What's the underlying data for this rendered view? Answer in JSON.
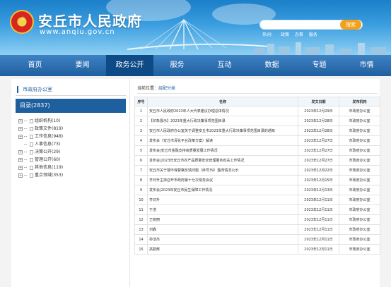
{
  "header": {
    "site_title": "安丘市人民政府",
    "site_url": "www.anqiu.gov.cn",
    "search_button": "搜索",
    "hot_label": "热词：",
    "hot_words": [
      "政策",
      "办事",
      "服务"
    ]
  },
  "nav": {
    "items": [
      "首页",
      "要闻",
      "政务公开",
      "服务",
      "互动",
      "数据",
      "专题",
      "市情"
    ],
    "active": "政务公开"
  },
  "sidebar": {
    "head": "市政府办公室",
    "catalog_label": "目录(2837)",
    "tree": [
      {
        "label": "组织机构(10)",
        "type": "folder"
      },
      {
        "label": "政策文件(819)",
        "type": "folder"
      },
      {
        "label": "工作信息(948)",
        "type": "folder"
      },
      {
        "label": "人事信息(73)",
        "type": "doc"
      },
      {
        "label": "决策公开(29)",
        "type": "folder"
      },
      {
        "label": "管理公开(60)",
        "type": "folder"
      },
      {
        "label": "其他信息(119)",
        "type": "folder"
      },
      {
        "label": "重点领域(353)",
        "type": "folder"
      }
    ]
  },
  "breadcrumb": {
    "label": "当前位置：",
    "current": "组配分类"
  },
  "table": {
    "headers": [
      "序号",
      "名称",
      "发文日期",
      "发布机构"
    ],
    "rows": [
      {
        "num": "1",
        "title": "安丘市人民政府2023年人大代表建议办理总体情况",
        "date": "2023年12月29日",
        "org": "市政府办公室"
      },
      {
        "num": "2",
        "title": "【印象展示】2023年重大行政决策事项范围目录",
        "date": "2023年12月28日",
        "org": "市政府办公室"
      },
      {
        "num": "3",
        "title": "安丘市人民政府办公室关于调整安丘市2023年重大行政决策事项范围目录的通知",
        "date": "2023年12月28日",
        "org": "市政府办公室"
      },
      {
        "num": "4",
        "title": "发布会（安丘市深化平台改革方案）解读",
        "date": "2023年12月27日",
        "org": "市政府办公室"
      },
      {
        "num": "5",
        "title": "发布会|安丘市金融支持高质量发展工作情况",
        "date": "2023年12月27日",
        "org": "市政府办公室"
      },
      {
        "num": "6",
        "title": "发布会|2023年安丘市农产品质量安全管理服务有关工作情况",
        "date": "2023年12月27日",
        "org": "市政府办公室"
      },
      {
        "num": "7",
        "title": "安丘市关于督环保督察反馈问题（序号39）整改情况公示",
        "date": "2023年12月22日",
        "org": "市政府办公室"
      },
      {
        "num": "8",
        "title": "齐日升主持召开市政府第十七次常务会议",
        "date": "2023年12月15日",
        "org": "市政府办公室"
      },
      {
        "num": "9",
        "title": "发布会|2023年安丘市民生保障工作情况",
        "date": "2023年12月13日",
        "org": "市政府办公室"
      },
      {
        "num": "10",
        "title": "齐日升",
        "date": "2023年12月11日",
        "org": "市政府办公室"
      },
      {
        "num": "11",
        "title": "于浩",
        "date": "2023年12月11日",
        "org": "市政府办公室"
      },
      {
        "num": "12",
        "title": "王晓丽",
        "date": "2023年12月11日",
        "org": "市政府办公室"
      },
      {
        "num": "13",
        "title": "刘鑫",
        "date": "2023年12月11日",
        "org": "市政府办公室"
      },
      {
        "num": "14",
        "title": "孙洁杰",
        "date": "2023年12月11日",
        "org": "市政府办公室"
      },
      {
        "num": "15",
        "title": "高勤辉",
        "date": "2023年12月11日",
        "org": "市政府办公室"
      }
    ]
  },
  "colors": {
    "nav_active": "#0d4a86",
    "accent": "#1e5f9e",
    "search_button": "#f2a11b"
  }
}
